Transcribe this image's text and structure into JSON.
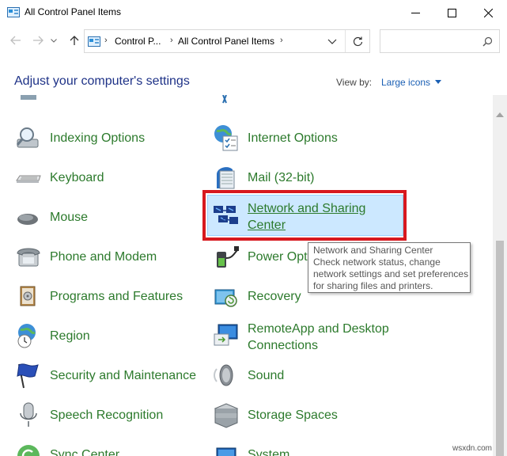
{
  "window": {
    "title": "All Control Panel Items",
    "minimize_icon": "minimize-icon",
    "maximize_icon": "maximize-icon",
    "close_icon": "close-icon"
  },
  "navigation": {
    "crumbs": [
      "Control P...",
      "All Control Panel Items"
    ],
    "search_placeholder": ""
  },
  "header": {
    "title": "Adjust your computer's settings",
    "view_by_label": "View by:",
    "view_by_value": "Large icons"
  },
  "items": {
    "indexing": "Indexing Options",
    "internet": "Internet Options",
    "keyboard": "Keyboard",
    "mail": "Mail (32-bit)",
    "mouse": "Mouse",
    "network_line1": "Network and Sharing",
    "network_line2": "Center",
    "phone": "Phone and Modem",
    "power": "Power Opti",
    "programs": "Programs and Features",
    "recovery": "Recovery",
    "region": "Region",
    "remoteapp_line1": "RemoteApp and Desktop",
    "remoteapp_line2": "Connections",
    "security": "Security and Maintenance",
    "sound": "Sound",
    "speech": "Speech Recognition",
    "storage": "Storage Spaces",
    "sync": "Sync Center",
    "system": "System"
  },
  "tooltip": {
    "line1": "Network and Sharing Center",
    "line2": "Check network status, change",
    "line3": "network settings and set preferences",
    "line4": "for sharing files and printers."
  },
  "colors": {
    "link_green": "#2c7a2c",
    "heading_blue": "#1e3287",
    "highlight_red": "#d7191f",
    "selection_blue": "#cce8ff"
  },
  "watermark": "wsxdn.com"
}
